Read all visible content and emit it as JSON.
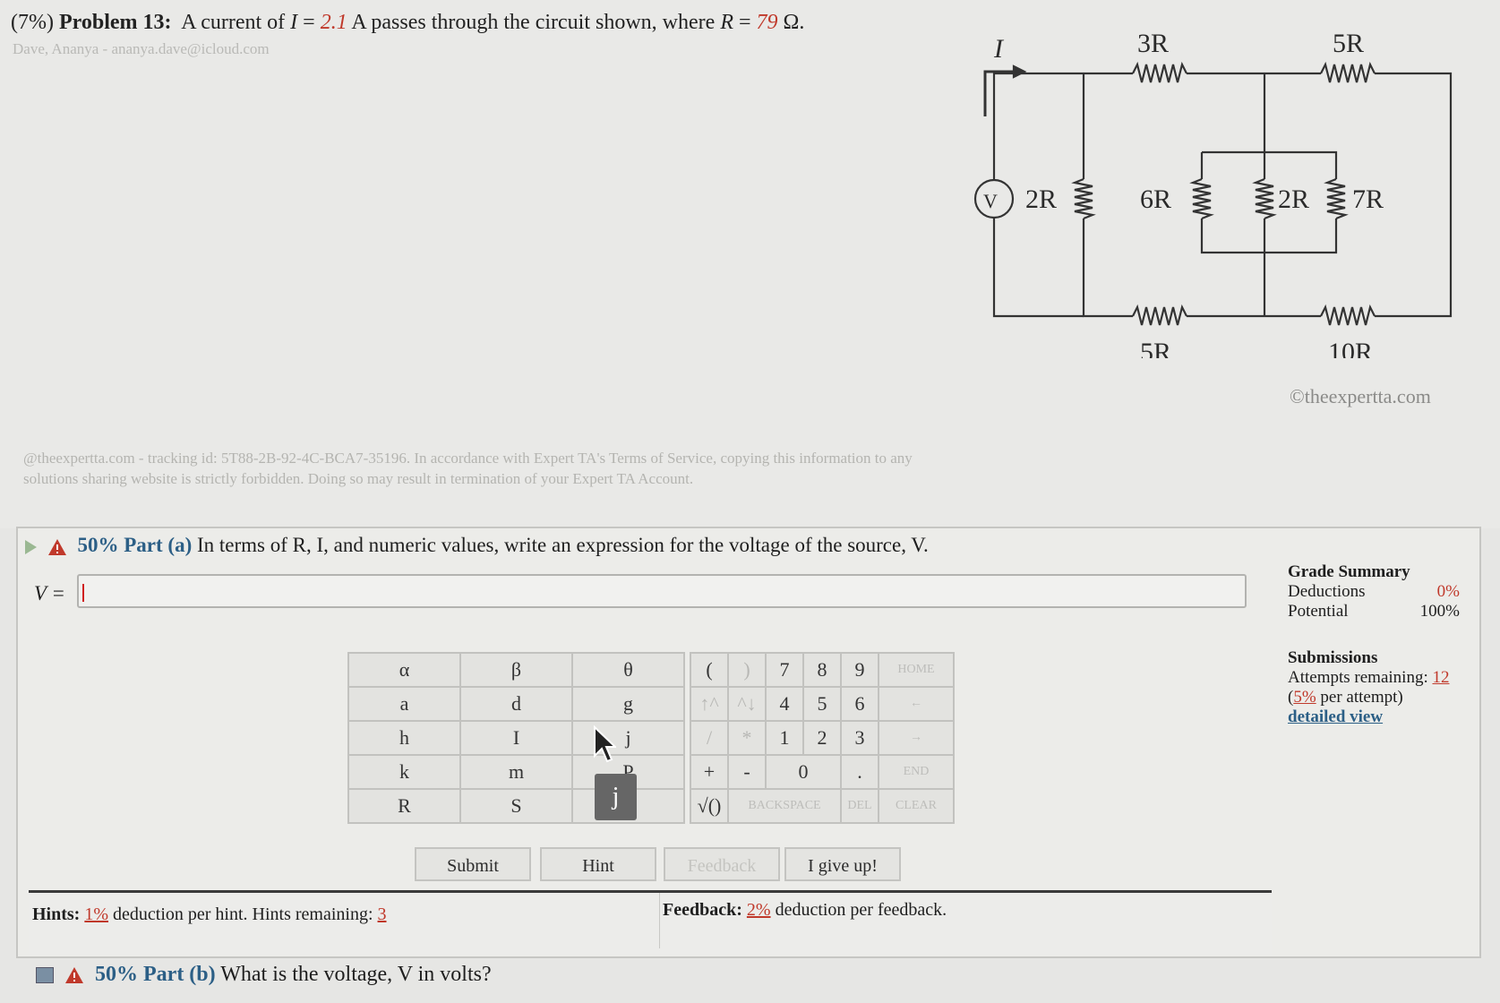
{
  "problem": {
    "weight": "(7%)",
    "label": "Problem 13:",
    "text_a": "A current of",
    "current_symbol": "I",
    "equals": " = ",
    "current_value": "2.1",
    "text_b": " A passes through the circuit shown, where ",
    "resistance_symbol": "R",
    "resistance_value": "79",
    "text_c": " Ω.",
    "student": "Dave, Ananya - ananya.dave@icloud.com"
  },
  "circuit": {
    "labels": {
      "current": "I",
      "source": "V",
      "r_top_left": "3R",
      "r_top_right": "5R",
      "r_left": "2R",
      "r_mid": "6R",
      "r_par_a": "2R",
      "r_par_b": "7R",
      "r_bot_left": "5R",
      "r_bot_right": "10R"
    },
    "copyright": "©theexpertta.com"
  },
  "tracking_note": "@theexpertta.com - tracking id: 5T88-2B-92-4C-BCA7-35196. In accordance with Expert TA's Terms of Service, copying this information to any solutions sharing website is strictly forbidden. Doing so may result in termination of your Expert TA Account.",
  "part_a": {
    "percent": "50%",
    "label": "Part (a)",
    "question": "In terms of R, I, and numeric values, write an expression for the voltage of the source, V.",
    "answer_label": "V =",
    "answer_value": ""
  },
  "keypad": {
    "letters": [
      [
        "α",
        "β",
        "θ"
      ],
      [
        "a",
        "d",
        "g"
      ],
      [
        "h",
        "I",
        "j"
      ],
      [
        "k",
        "m",
        "P"
      ],
      [
        "R",
        "S",
        "t"
      ]
    ],
    "row1": [
      "(",
      ")",
      "7",
      "8",
      "9",
      "HOME"
    ],
    "row2": [
      "↑^",
      "^↓",
      "4",
      "5",
      "6",
      "←"
    ],
    "row3": [
      "/",
      "*",
      "1",
      "2",
      "3",
      "→"
    ],
    "row4": [
      "+",
      "-",
      "0",
      ".",
      "END"
    ],
    "row5": [
      "√()",
      "BACKSPACE",
      "DEL",
      "CLEAR"
    ],
    "tooltip": "j"
  },
  "buttons": {
    "submit": "Submit",
    "hint": "Hint",
    "feedback": "Feedback",
    "give_up": "I give up!"
  },
  "hints": {
    "label": "Hints:",
    "deduction": "1%",
    "text": "deduction per hint. Hints remaining:",
    "remaining": "3"
  },
  "feedback": {
    "label": "Feedback:",
    "deduction": "2%",
    "text": "deduction per feedback."
  },
  "grade_summary": {
    "title": "Grade Summary",
    "deductions_label": "Deductions",
    "deductions_value": "0%",
    "potential_label": "Potential",
    "potential_value": "100%"
  },
  "submissions": {
    "title": "Submissions",
    "attempts_label": "Attempts remaining:",
    "attempts_value": "12",
    "per_attempt_pct": "5%",
    "per_attempt_text": "per attempt)",
    "detailed_view": "detailed view"
  },
  "part_b": {
    "percent": "50%",
    "label": "Part (b)",
    "question": "What is the voltage, V in volts?"
  },
  "colors": {
    "accent_blue": "#2c5f86",
    "value_red": "#c0392b"
  }
}
